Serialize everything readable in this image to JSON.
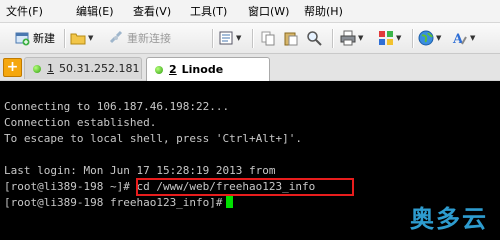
{
  "menu": [
    "文件(F)",
    "编辑(E)",
    "查看(V)",
    "工具(T)",
    "窗口(W)",
    "帮助(H)"
  ],
  "toolbar": {
    "new_label": "新建",
    "reconnect_label": "重新连接"
  },
  "tabs": [
    {
      "num": "1",
      "title": "50.31.252.181"
    },
    {
      "num": "2",
      "title": "Linode"
    }
  ],
  "terminal": {
    "lines": [
      "Connecting to 106.187.46.198:22...",
      "Connection established.",
      "To escape to local shell, press 'Ctrl+Alt+]'.",
      "",
      "Last login: Mon Jun 17 15:28:19 2013 from",
      "[root@li389-198 ~]# cd /www/web/freehao123_info",
      "[root@li389-198 freehao123_info]#"
    ]
  },
  "watermark": "奥多云",
  "colors": {
    "terminal_bg": "#000000",
    "terminal_text": "#c8c8c8",
    "cursor": "#00e000",
    "highlight_border": "#e81d1d",
    "tab_status_dot": "#2f9e10",
    "watermark": "#2e9ccf"
  }
}
